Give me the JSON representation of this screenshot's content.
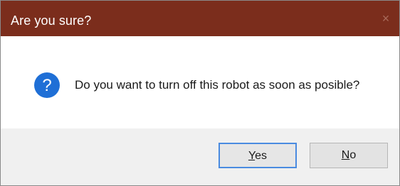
{
  "window": {
    "title": "Are you sure?",
    "close_glyph": "×"
  },
  "message": {
    "icon": "question-icon",
    "text": "Do you want to turn off this robot as soon as posible?"
  },
  "buttons": {
    "yes": {
      "mnemonic": "Y",
      "rest": "es"
    },
    "no": {
      "mnemonic": "N",
      "rest": "o"
    }
  },
  "colors": {
    "titlebar": "#7b2d1c",
    "icon": "#1f6fd6",
    "focus_border": "#4a8be0"
  }
}
